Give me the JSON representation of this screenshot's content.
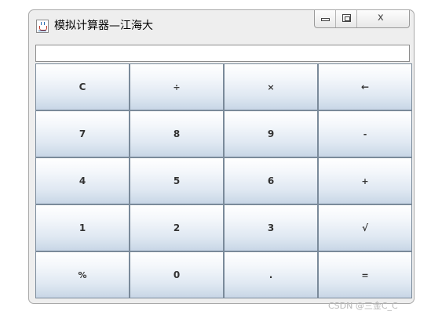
{
  "window": {
    "title": "模拟计算器—江海大",
    "icon": "java-cup-icon",
    "controls": {
      "minimize_icon": "minimize-icon",
      "maximize_icon": "maximize-icon",
      "close_glyph": "ⅹ"
    }
  },
  "display": {
    "value": ""
  },
  "keypad": {
    "rows": [
      [
        "C",
        "÷",
        "×",
        "←"
      ],
      [
        "7",
        "8",
        "9",
        "-"
      ],
      [
        "4",
        "5",
        "6",
        "+"
      ],
      [
        "1",
        "2",
        "3",
        "√"
      ],
      [
        "%",
        "0",
        ".",
        "="
      ]
    ]
  },
  "watermark": "CSDN @三金C_C",
  "colors": {
    "button_top": "#ffffff",
    "button_bottom": "#c8d6e6",
    "button_border": "#7a8a9a",
    "window_bg": "#eeeeee"
  }
}
